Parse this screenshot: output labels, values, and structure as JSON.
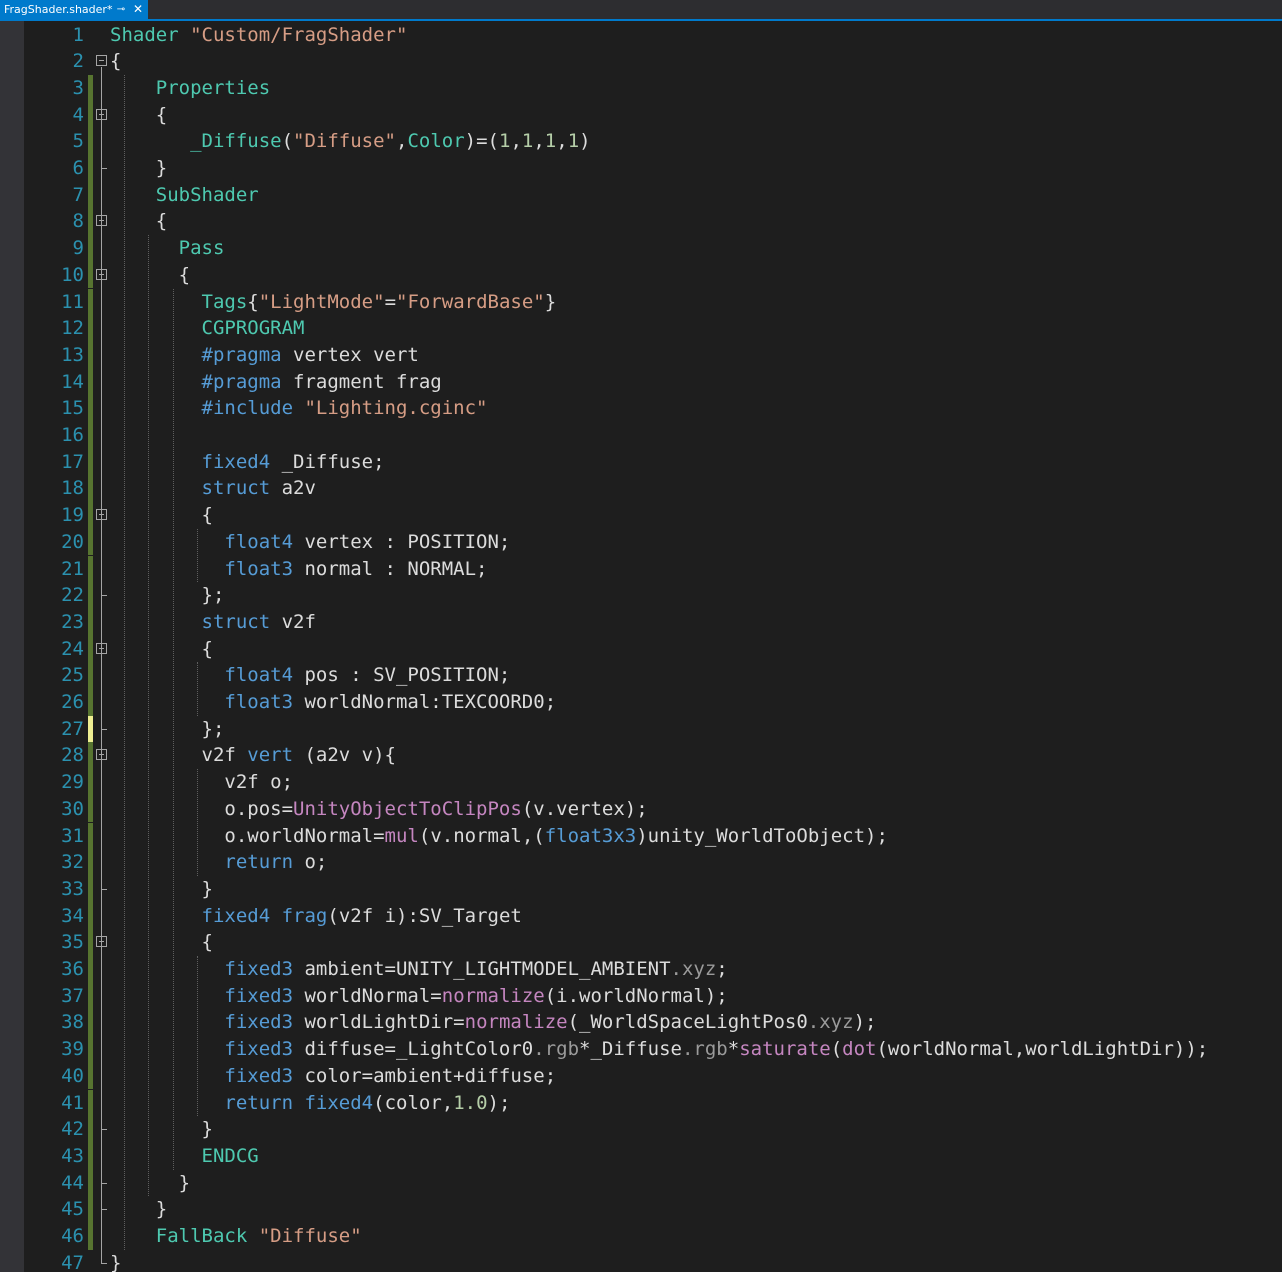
{
  "tab": {
    "title": "FragShader.shader*",
    "pin_icon": "⊸",
    "close_icon": "✕"
  },
  "colors": {
    "accent": "#007acc",
    "line_numbers": "#2b91af",
    "saved_change": "#577430",
    "unsaved_change": "#efef92"
  },
  "lines": [
    {
      "n": "1",
      "t": [
        [
          "sh",
          "Shader "
        ],
        [
          "str",
          "\"Custom/FragShader\""
        ]
      ]
    },
    {
      "n": "2",
      "t": [
        [
          "",
          "{"
        ]
      ]
    },
    {
      "n": "3",
      "t": [
        [
          "",
          "    "
        ],
        [
          "sh",
          "Properties"
        ]
      ]
    },
    {
      "n": "4",
      "t": [
        [
          "",
          "    {"
        ]
      ]
    },
    {
      "n": "5",
      "t": [
        [
          "",
          "       "
        ],
        [
          "sh",
          "_Diffuse"
        ],
        [
          "",
          "("
        ],
        [
          "str",
          "\"Diffuse\""
        ],
        [
          "",
          ","
        ],
        [
          "sh",
          "Color"
        ],
        [
          "",
          ")=("
        ],
        [
          "num",
          "1"
        ],
        [
          "",
          ","
        ],
        [
          "num",
          "1"
        ],
        [
          "",
          ","
        ],
        [
          "num",
          "1"
        ],
        [
          "",
          ","
        ],
        [
          "num",
          "1"
        ],
        [
          "",
          ")"
        ]
      ]
    },
    {
      "n": "6",
      "t": [
        [
          "",
          "    }"
        ]
      ]
    },
    {
      "n": "7",
      "t": [
        [
          "",
          "    "
        ],
        [
          "sh",
          "SubShader"
        ]
      ]
    },
    {
      "n": "8",
      "t": [
        [
          "",
          "    {"
        ]
      ]
    },
    {
      "n": "9",
      "t": [
        [
          "",
          "      "
        ],
        [
          "sh",
          "Pass"
        ]
      ]
    },
    {
      "n": "10",
      "t": [
        [
          "",
          "      {"
        ]
      ]
    },
    {
      "n": "11",
      "t": [
        [
          "",
          "        "
        ],
        [
          "sh",
          "Tags"
        ],
        [
          "",
          "{"
        ],
        [
          "str",
          "\"LightMode\""
        ],
        [
          "",
          "="
        ],
        [
          "str",
          "\"ForwardBase\""
        ],
        [
          "",
          "}"
        ]
      ]
    },
    {
      "n": "12",
      "t": [
        [
          "",
          "        "
        ],
        [
          "sh",
          "CGPROGRAM"
        ]
      ]
    },
    {
      "n": "13",
      "t": [
        [
          "",
          "        "
        ],
        [
          "kw",
          "#pragma"
        ],
        [
          "",
          " vertex vert"
        ]
      ]
    },
    {
      "n": "14",
      "t": [
        [
          "",
          "        "
        ],
        [
          "kw",
          "#pragma"
        ],
        [
          "",
          " fragment frag"
        ]
      ]
    },
    {
      "n": "15",
      "t": [
        [
          "",
          "        "
        ],
        [
          "kw",
          "#include"
        ],
        [
          "str",
          " \"Lighting.cginc\""
        ]
      ]
    },
    {
      "n": "16",
      "t": [
        [
          "",
          ""
        ]
      ]
    },
    {
      "n": "17",
      "t": [
        [
          "",
          "        "
        ],
        [
          "kw",
          "fixed4"
        ],
        [
          "",
          " _Diffuse;"
        ]
      ]
    },
    {
      "n": "18",
      "t": [
        [
          "",
          "        "
        ],
        [
          "kw",
          "struct"
        ],
        [
          "",
          " a2v"
        ]
      ]
    },
    {
      "n": "19",
      "t": [
        [
          "",
          "        {"
        ]
      ]
    },
    {
      "n": "20",
      "t": [
        [
          "",
          "          "
        ],
        [
          "kw",
          "float4"
        ],
        [
          "",
          " vertex : POSITION;"
        ]
      ]
    },
    {
      "n": "21",
      "t": [
        [
          "",
          "          "
        ],
        [
          "kw",
          "float3"
        ],
        [
          "",
          " normal : NORMAL;"
        ]
      ]
    },
    {
      "n": "22",
      "t": [
        [
          "",
          "        };"
        ]
      ]
    },
    {
      "n": "23",
      "t": [
        [
          "",
          "        "
        ],
        [
          "kw",
          "struct"
        ],
        [
          "",
          " v2f"
        ]
      ]
    },
    {
      "n": "24",
      "t": [
        [
          "",
          "        {"
        ]
      ]
    },
    {
      "n": "25",
      "t": [
        [
          "",
          "          "
        ],
        [
          "kw",
          "float4"
        ],
        [
          "",
          " pos : SV_POSITION;"
        ]
      ]
    },
    {
      "n": "26",
      "t": [
        [
          "",
          "          "
        ],
        [
          "kw",
          "float3"
        ],
        [
          "",
          " worldNormal:TEXCOORD0;"
        ]
      ]
    },
    {
      "n": "27",
      "t": [
        [
          "",
          "        };"
        ]
      ]
    },
    {
      "n": "28",
      "t": [
        [
          "",
          "        v2f "
        ],
        [
          "kw",
          "vert"
        ],
        [
          "",
          " (a2v v){"
        ]
      ]
    },
    {
      "n": "29",
      "t": [
        [
          "",
          "          v2f o;"
        ]
      ]
    },
    {
      "n": "30",
      "t": [
        [
          "",
          "          o.pos="
        ],
        [
          "fn",
          "UnityObjectToClipPos"
        ],
        [
          "",
          "(v.vertex);"
        ]
      ]
    },
    {
      "n": "31",
      "t": [
        [
          "",
          "          o.worldNormal="
        ],
        [
          "fn",
          "mul"
        ],
        [
          "",
          "(v.normal,("
        ],
        [
          "kw",
          "float3x3"
        ],
        [
          "",
          ")unity_WorldToObject);"
        ]
      ]
    },
    {
      "n": "32",
      "t": [
        [
          "",
          "          "
        ],
        [
          "kw",
          "return"
        ],
        [
          "",
          " o;"
        ]
      ]
    },
    {
      "n": "33",
      "t": [
        [
          "",
          "        }"
        ]
      ]
    },
    {
      "n": "34",
      "t": [
        [
          "",
          "        "
        ],
        [
          "kw",
          "fixed4"
        ],
        [
          "",
          " "
        ],
        [
          "kw",
          "frag"
        ],
        [
          "",
          "(v2f i):SV_Target"
        ]
      ]
    },
    {
      "n": "35",
      "t": [
        [
          "",
          "        {"
        ]
      ]
    },
    {
      "n": "36",
      "t": [
        [
          "",
          "          "
        ],
        [
          "kw",
          "fixed3"
        ],
        [
          "",
          " ambient=UNITY_LIGHTMODEL_AMBIENT"
        ],
        [
          "pp",
          ".xyz"
        ],
        [
          "",
          ";"
        ]
      ]
    },
    {
      "n": "37",
      "t": [
        [
          "",
          "          "
        ],
        [
          "kw",
          "fixed3"
        ],
        [
          "",
          " worldNormal="
        ],
        [
          "fn",
          "normalize"
        ],
        [
          "",
          "(i.worldNormal);"
        ]
      ]
    },
    {
      "n": "38",
      "t": [
        [
          "",
          "          "
        ],
        [
          "kw",
          "fixed3"
        ],
        [
          "",
          " worldLightDir="
        ],
        [
          "fn",
          "normalize"
        ],
        [
          "",
          "(_WorldSpaceLightPos0"
        ],
        [
          "pp",
          ".xyz"
        ],
        [
          "",
          ");"
        ]
      ]
    },
    {
      "n": "39",
      "t": [
        [
          "",
          "          "
        ],
        [
          "kw",
          "fixed3"
        ],
        [
          "",
          " diffuse=_LightColor0"
        ],
        [
          "pp",
          ".rgb"
        ],
        [
          "",
          "*_Diffuse"
        ],
        [
          "pp",
          ".rgb"
        ],
        [
          "",
          "*"
        ],
        [
          "fn",
          "saturate"
        ],
        [
          "",
          "("
        ],
        [
          "fn",
          "dot"
        ],
        [
          "",
          "(worldNormal,worldLightDir));"
        ]
      ]
    },
    {
      "n": "40",
      "t": [
        [
          "",
          "          "
        ],
        [
          "kw",
          "fixed3"
        ],
        [
          "",
          " color=ambient+diffuse;"
        ]
      ]
    },
    {
      "n": "41",
      "t": [
        [
          "",
          "          "
        ],
        [
          "kw",
          "return"
        ],
        [
          "",
          " "
        ],
        [
          "kw",
          "fixed4"
        ],
        [
          "",
          "(color,"
        ],
        [
          "num",
          "1.0"
        ],
        [
          "",
          ");"
        ]
      ]
    },
    {
      "n": "42",
      "t": [
        [
          "",
          "        }"
        ]
      ]
    },
    {
      "n": "43",
      "t": [
        [
          "",
          "        "
        ],
        [
          "sh",
          "ENDCG"
        ]
      ]
    },
    {
      "n": "44",
      "t": [
        [
          "",
          "      }"
        ]
      ]
    },
    {
      "n": "45",
      "t": [
        [
          "",
          "    }"
        ]
      ]
    },
    {
      "n": "46",
      "t": [
        [
          "",
          "    "
        ],
        [
          "sh",
          "FallBack "
        ],
        [
          "str",
          "\"Diffuse\""
        ]
      ]
    },
    {
      "n": "47",
      "t": [
        [
          "",
          "}"
        ]
      ]
    }
  ]
}
